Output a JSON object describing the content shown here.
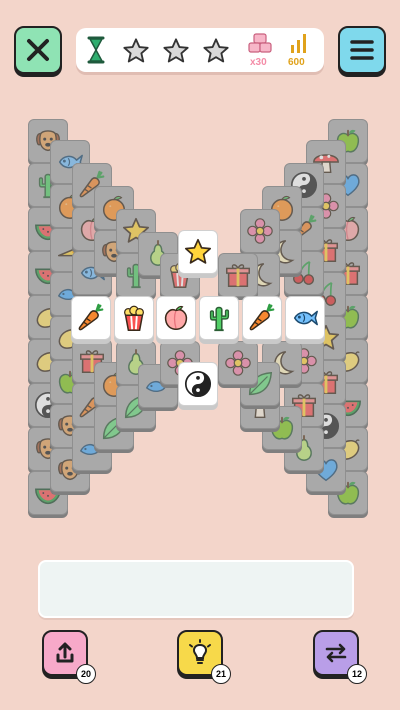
{
  "header": {
    "stars_total": 3,
    "stars_earned": 0,
    "tiles_remaining": "x30",
    "score": "600"
  },
  "board": {
    "icon_types": [
      "dog",
      "fish",
      "cactus",
      "carrot",
      "orange",
      "peach",
      "star",
      "apple",
      "watermelon",
      "lemon",
      "pear",
      "cheese",
      "gift",
      "popcorn",
      "flower",
      "bird",
      "moon",
      "mushroom",
      "yinyang",
      "heart",
      "cherry",
      "leaf"
    ]
  },
  "powerups": [
    {
      "name": "undo",
      "count": "20",
      "color": "#f7a9c9"
    },
    {
      "name": "hint",
      "count": "21",
      "color": "#f7d94a"
    },
    {
      "name": "shuffle",
      "count": "12",
      "color": "#b99ee8"
    }
  ],
  "colors": {
    "background": "#f3d5ca",
    "close_button": "#8fe3b4",
    "menu_button": "#7fd9ec",
    "stars_empty": "#d9d9d9",
    "tiles_icon": "#f48ca7",
    "score_icon": "#e0a21b",
    "timer": "#1f8f5a"
  }
}
